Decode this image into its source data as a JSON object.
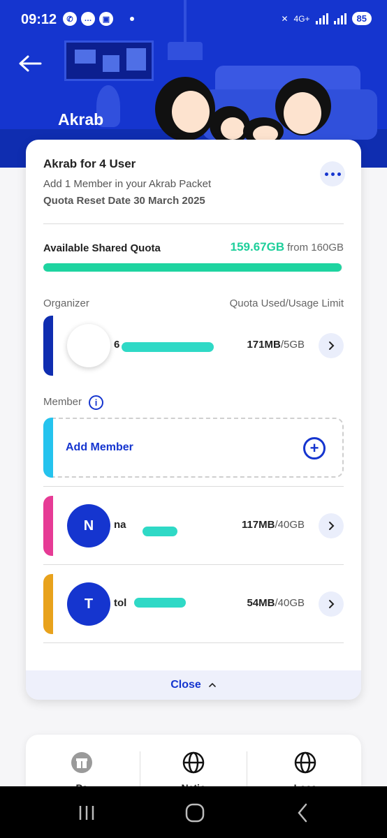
{
  "status_bar": {
    "time": "09:12",
    "network": "4G+",
    "battery": "85"
  },
  "header": {
    "title": "Akrab"
  },
  "package": {
    "title": "Akrab for 4 User",
    "subtitle": "Add 1 Member in your Akrab Packet",
    "reset_date": "Quota Reset Date 30 March 2025"
  },
  "quota": {
    "label": "Available Shared Quota",
    "value": "159.67GB",
    "total": "from 160GB",
    "fill_fraction": 0.998
  },
  "organizer": {
    "section_label": "Organizer",
    "right_label": "Quota Used/Usage Limit",
    "name": "6",
    "used": "171MB",
    "limit": "/5GB",
    "accent": "#0f2db0"
  },
  "members_section": {
    "label": "Member",
    "add_label": "Add Member"
  },
  "members": [
    {
      "initial": "N",
      "name": "na",
      "used": "117MB",
      "limit": "/40GB",
      "accent": "#e63b95"
    },
    {
      "initial": "T",
      "name": "tol",
      "used": "54MB",
      "limit": "/40GB",
      "accent": "#e8a21c"
    }
  ],
  "close": {
    "label": "Close"
  },
  "menu": {
    "items": [
      {
        "label": "Pa",
        "icon": "gift-icon"
      },
      {
        "label": "Natio",
        "icon": "globe-icon"
      },
      {
        "label": "Loca",
        "icon": "globe-icon"
      }
    ]
  },
  "colors": {
    "brand": "#1535cf",
    "quota_green": "#1ecf9b",
    "add_accent": "#25c3ee"
  }
}
